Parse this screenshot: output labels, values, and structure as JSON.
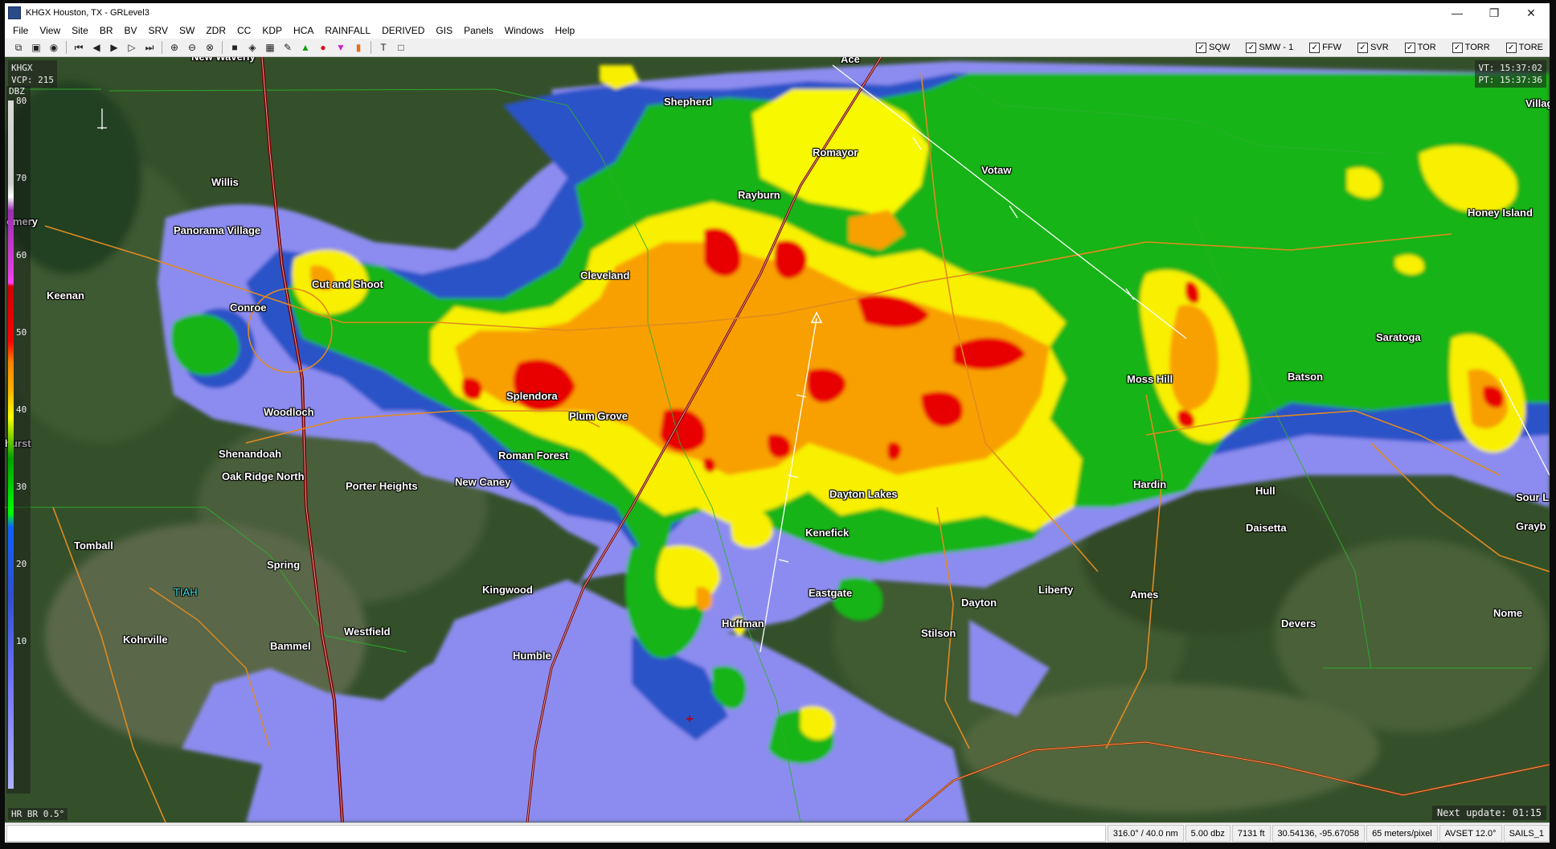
{
  "window": {
    "title": "KHGX Houston, TX - GRLevel3",
    "minimize": "—",
    "maximize": "❐",
    "close": "✕"
  },
  "menu": [
    "File",
    "View",
    "Site",
    "BR",
    "BV",
    "SRV",
    "SW",
    "ZDR",
    "CC",
    "KDP",
    "HCA",
    "RAINFALL",
    "DERIVED",
    "GIS",
    "Panels",
    "Windows",
    "Help"
  ],
  "toolbar": {
    "tools": [
      "copy-icon",
      "paste-icon",
      "color-table-icon",
      "first-frame-icon",
      "prev-frame-icon",
      "play-icon",
      "next-frame-icon",
      "last-frame-icon",
      "zoom-in-icon",
      "zoom-out-icon",
      "zoom-reset-icon",
      "stop-icon",
      "storm-track-icon",
      "table-icon",
      "pen-icon",
      "triangle-icon",
      "circle-icon",
      "down-triangle-icon",
      "marker-icon",
      "text-icon",
      "box-icon"
    ],
    "warnings": [
      {
        "label": "SQW",
        "checked": true
      },
      {
        "label": "SMW - 1",
        "checked": true
      },
      {
        "label": "FFW",
        "checked": true
      },
      {
        "label": "SVR",
        "checked": true
      },
      {
        "label": "TOR",
        "checked": true
      },
      {
        "label": "TORR",
        "checked": true
      },
      {
        "label": "TORE",
        "checked": true
      }
    ]
  },
  "radar": {
    "site": "KHGX",
    "vcp": "VCP: 215",
    "vt": "VT: 15:37:02",
    "pt": "PT: 15:37:36",
    "unit": "DBZ",
    "scale": [
      "80",
      "70",
      "60",
      "50",
      "40",
      "30",
      "20",
      "10"
    ],
    "product": "HR BR 0.5°",
    "next_update": "Next update: 01:15"
  },
  "places": [
    {
      "name": "New Waverly"
    },
    {
      "name": "Ace"
    },
    {
      "name": "Shepherd"
    },
    {
      "name": "Willis"
    },
    {
      "name": "Romayor"
    },
    {
      "name": "Votaw"
    },
    {
      "name": "Rayburn"
    },
    {
      "name": "Village"
    },
    {
      "name": "Honey Island"
    },
    {
      "name": "omery"
    },
    {
      "name": "Panorama Village"
    },
    {
      "name": "Cut and Shoot"
    },
    {
      "name": "Cleveland"
    },
    {
      "name": "Keenan"
    },
    {
      "name": "Conroe"
    },
    {
      "name": "Saratoga"
    },
    {
      "name": "Moss Hill"
    },
    {
      "name": "Batson"
    },
    {
      "name": "Splendora"
    },
    {
      "name": "Woodloch"
    },
    {
      "name": "Plum Grove"
    },
    {
      "name": "Shenandoah"
    },
    {
      "name": "Roman Forest"
    },
    {
      "name": "Oak Ridge North"
    },
    {
      "name": "New Caney"
    },
    {
      "name": "Porter Heights"
    },
    {
      "name": "Hardin"
    },
    {
      "name": "Dayton Lakes"
    },
    {
      "name": "Hull"
    },
    {
      "name": "Sour L"
    },
    {
      "name": "Kenefick"
    },
    {
      "name": "Daisetta"
    },
    {
      "name": "Grayb"
    },
    {
      "name": "Tomball"
    },
    {
      "name": "Spring"
    },
    {
      "name": "Kingwood"
    },
    {
      "name": "Eastgate"
    },
    {
      "name": "Liberty"
    },
    {
      "name": "Ames"
    },
    {
      "name": "Dayton"
    },
    {
      "name": "Huffman"
    },
    {
      "name": "Devers"
    },
    {
      "name": "Nome"
    },
    {
      "name": "Stilson"
    },
    {
      "name": "Westfield"
    },
    {
      "name": "Kohrville"
    },
    {
      "name": "Bammel"
    },
    {
      "name": "Humble"
    },
    {
      "name": "hurst"
    },
    {
      "name": "TIAH"
    }
  ],
  "status": {
    "azimuth": "316.0° / 40.0 nm",
    "value": "5.00 dbz",
    "height": "7131 ft",
    "latlon": "30.54136, -95.67058",
    "resolution": "65 meters/pixel",
    "avset": "AVSET 12.0°",
    "sails": "SAILS_1"
  }
}
